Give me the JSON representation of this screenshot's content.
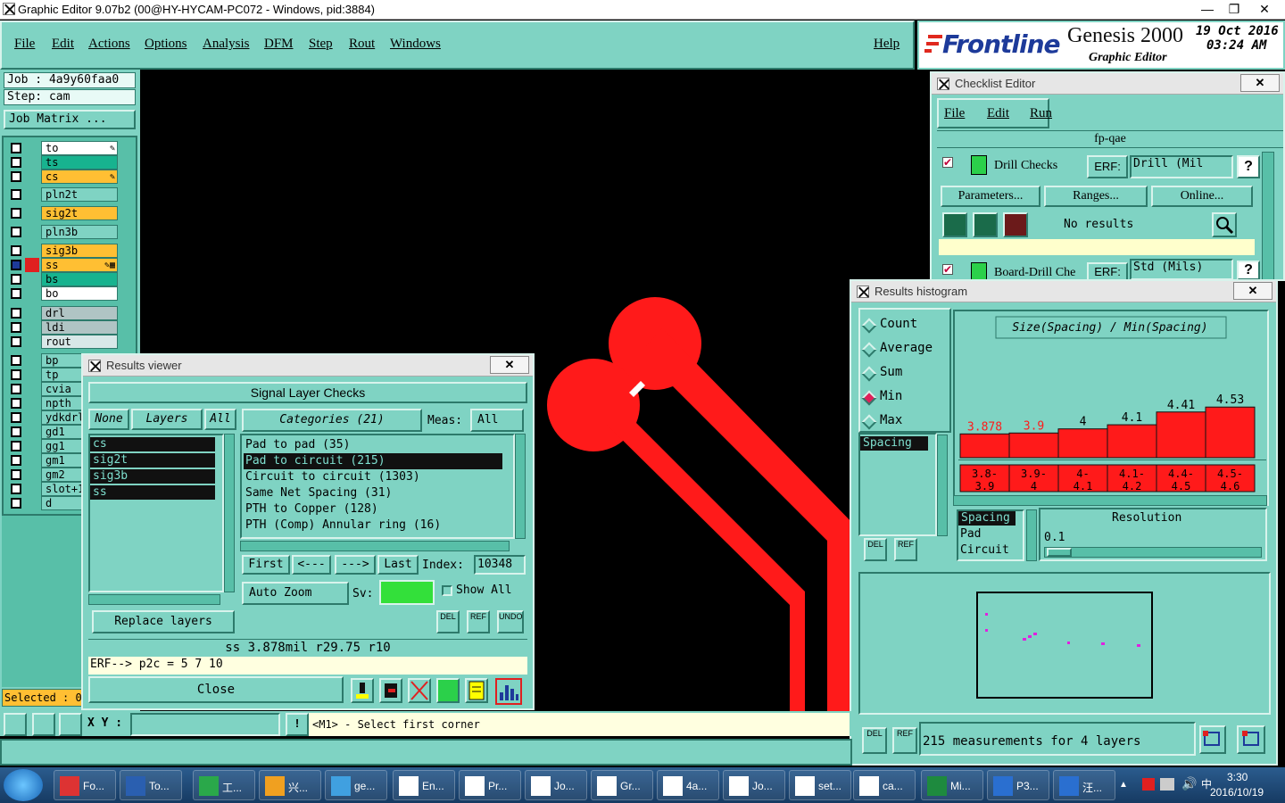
{
  "window": {
    "title": "Graphic Editor 9.07b2 (00@HY-HYCAM-PC072 - Windows, pid:3884)",
    "min": "—",
    "max": "❐",
    "close": "✕"
  },
  "menu": {
    "items": [
      "File",
      "Edit",
      "Actions",
      "Options",
      "Analysis",
      "DFM",
      "Step",
      "Rout",
      "Windows"
    ],
    "help": "Help"
  },
  "logo": {
    "brand": "Frontline",
    "product": "Genesis 2000",
    "sub": "Graphic Editor",
    "date": "19 Oct 2016",
    "time": "03:24 AM"
  },
  "left": {
    "job": "Job : 4a9y60faa0",
    "step": "Step: cam",
    "job_matrix": "Job Matrix ...",
    "selected": "Selected : 0",
    "layers": [
      {
        "name": "to",
        "color": "#ffffff",
        "mark": "✎"
      },
      {
        "name": "ts",
        "color": "#17b38f",
        "mark": ""
      },
      {
        "name": "cs",
        "color": "#ffbf33",
        "mark": "✎"
      },
      {
        "name": "pln2t",
        "color": "#7fd3c3",
        "mark": ""
      },
      {
        "name": "sig2t",
        "color": "#ffbf33",
        "mark": ""
      },
      {
        "name": "pln3b",
        "color": "#7fd3c3",
        "mark": ""
      },
      {
        "name": "sig3b",
        "color": "#ffbf33",
        "mark": ""
      },
      {
        "name": "ss",
        "color": "#ffbf33",
        "mark": "✎▦"
      },
      {
        "name": "bs",
        "color": "#17b38f",
        "mark": ""
      },
      {
        "name": "bo",
        "color": "#ffffff",
        "mark": ""
      },
      {
        "name": "drl",
        "color": "#b0c4c4",
        "mark": ""
      },
      {
        "name": "ldi",
        "color": "#b0c4c4",
        "mark": ""
      },
      {
        "name": "rout",
        "color": "#d8e8e8",
        "mark": ""
      },
      {
        "name": "bp",
        "color": "#7fd3c3",
        "mark": ""
      },
      {
        "name": "tp",
        "color": "#7fd3c3",
        "mark": ""
      },
      {
        "name": "cvia",
        "color": "#7fd3c3",
        "mark": ""
      },
      {
        "name": "npth",
        "color": "#7fd3c3",
        "mark": ""
      },
      {
        "name": "ydkdrl",
        "color": "#7fd3c3",
        "mark": ""
      },
      {
        "name": "gd1",
        "color": "#7fd3c3",
        "mark": ""
      },
      {
        "name": "gg1",
        "color": "#7fd3c3",
        "mark": ""
      },
      {
        "name": "gm1",
        "color": "#7fd3c3",
        "mark": ""
      },
      {
        "name": "gm2",
        "color": "#7fd3c3",
        "mark": ""
      },
      {
        "name": "slot+1",
        "color": "#7fd3c3",
        "mark": ""
      },
      {
        "name": "d",
        "color": "#7fd3c3",
        "mark": ""
      }
    ]
  },
  "checklist": {
    "title": "Checklist Editor",
    "menu": [
      "File",
      "Edit",
      "Run"
    ],
    "name": "fp-qae",
    "check1": {
      "label": "Drill Checks",
      "erf_label": "ERF:",
      "erf_value": "Drill (Mil",
      "help": "?"
    },
    "buttons": [
      "Parameters...",
      "Ranges...",
      "Online..."
    ],
    "no_results": "No results",
    "check2": {
      "label": "Board-Drill Che",
      "erf_label": "ERF:",
      "erf_value": "Std (Mils)",
      "help": "?"
    }
  },
  "viewer": {
    "title": "Results viewer",
    "header": "Signal Layer Checks",
    "none": "None",
    "layers_label": "Layers",
    "all": "All",
    "layers": [
      "cs",
      "sig2t",
      "sig3b",
      "ss"
    ],
    "categories_label": "Categories (21)",
    "meas_label": "Meas:",
    "meas_value": "All",
    "categories": [
      "Pad to pad (35)",
      "Pad to circuit (215)",
      "Circuit to circuit (1303)",
      "Same Net Spacing (31)",
      "PTH to Copper (128)",
      "PTH (Comp) Annular ring (16)"
    ],
    "selected_category": 1,
    "nav": [
      "First",
      "<---",
      "--->",
      "Last"
    ],
    "index_label": "Index:",
    "index_value": "10348",
    "auto_zoom": "Auto Zoom",
    "sv_label": "Sv:",
    "show_all": "Show All",
    "replace_layers": "Replace layers",
    "del": "DEL",
    "ref": "REF",
    "undo": "UNDO",
    "measurement": "ss 3.878mil   r29.75   r10",
    "erf_line": "ERF--> p2c = 5 7 10",
    "close": "Close"
  },
  "histogram": {
    "title": "Results histogram",
    "modes": [
      "Count",
      "Average",
      "Sum",
      "Min",
      "Max"
    ],
    "selected_mode": "Min",
    "chart_title": "Size(Spacing) / Min(Spacing)",
    "list": [
      "Spacing"
    ],
    "list2": [
      "Spacing",
      "Pad",
      "Circuit"
    ],
    "resolution_label": "Resolution",
    "resolution_value": "0.1",
    "del": "DEL",
    "ref": "REF",
    "summary": "215 measurements for 4 layers"
  },
  "chart_data": {
    "type": "bar",
    "title": "Size(Spacing) / Min(Spacing)",
    "categories": [
      "3.8-3.9",
      "3.9-4",
      "4-4.1",
      "4.1-4.2",
      "4.4-4.5",
      "4.5-4.6"
    ],
    "category_labels_top": [
      "3.8-",
      "3.9-",
      "4-",
      "4.1-",
      "4.4-",
      "4.5-"
    ],
    "category_labels_bottom": [
      "3.9",
      "4",
      "4.1",
      "4.2",
      "4.5",
      "4.6"
    ],
    "values": [
      3.878,
      3.9,
      4,
      4.1,
      4.41,
      4.53
    ],
    "value_labels": [
      "3.878",
      "3.9",
      "4",
      "4.1",
      "4.41",
      "4.53"
    ],
    "value_colors": [
      "#ff1a1a",
      "#ff1a1a",
      "#000000",
      "#000000",
      "#000000",
      "#000000"
    ],
    "ylim": [
      3.3,
      4.6
    ],
    "bar_color": "#ff1a1a"
  },
  "status": {
    "xy_label": "X Y :",
    "message": "<M1> - Select first corner",
    "warn": "!"
  },
  "taskbar": {
    "items": [
      {
        "label": "Fo...",
        "color": "#d33"
      },
      {
        "label": "To...",
        "color": "#2a5fb0"
      },
      {
        "label": "工...",
        "color": "#2aa84a"
      },
      {
        "label": "兴...",
        "color": "#f0a020"
      },
      {
        "label": "ge...",
        "color": "#40a0e0"
      },
      {
        "label": "En...",
        "color": "#ffffff"
      },
      {
        "label": "Pr...",
        "color": "#ffffff"
      },
      {
        "label": "Jo...",
        "color": "#ffffff"
      },
      {
        "label": "Gr...",
        "color": "#ffffff"
      },
      {
        "label": "4a...",
        "color": "#ffffff"
      },
      {
        "label": "Jo...",
        "color": "#ffffff"
      },
      {
        "label": "set...",
        "color": "#ffffff"
      },
      {
        "label": "ca...",
        "color": "#ffffff"
      },
      {
        "label": "Mi...",
        "color": "#1e8a3e"
      },
      {
        "label": "P3...",
        "color": "#2a6fd0"
      },
      {
        "label": "汪...",
        "color": "#2a6fd0"
      }
    ],
    "time": "3:30",
    "date": "2016/10/19"
  }
}
